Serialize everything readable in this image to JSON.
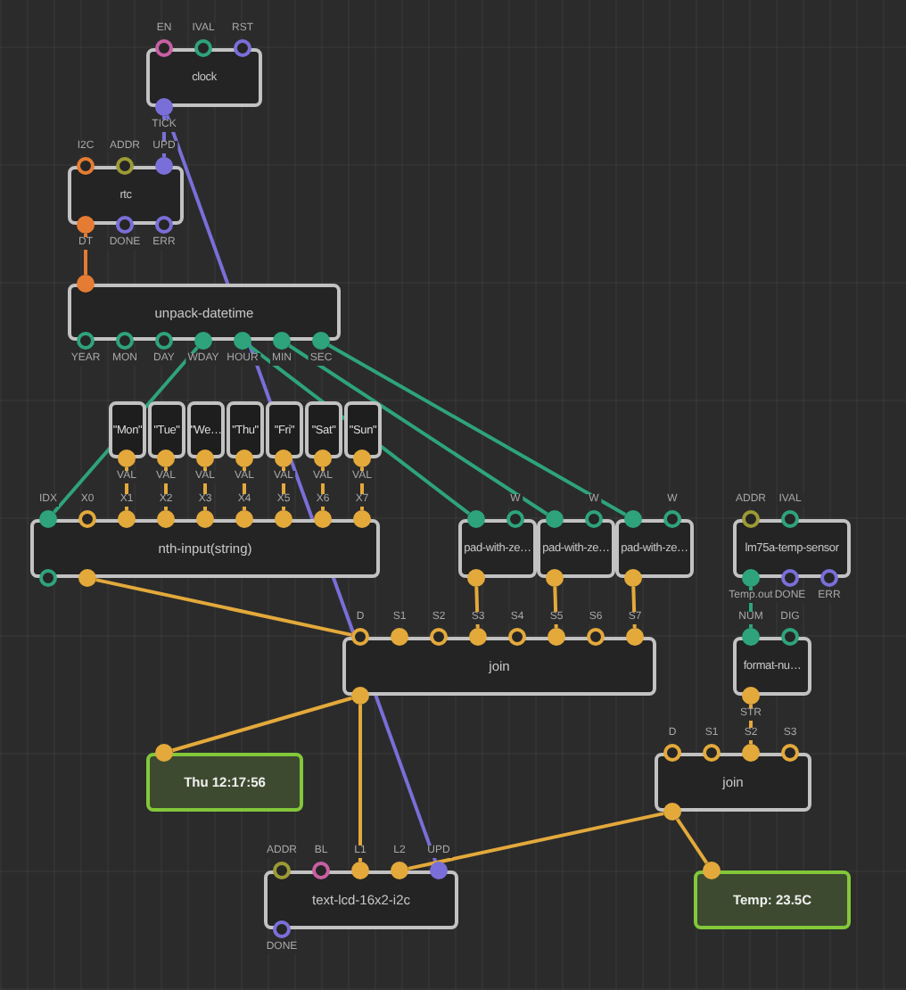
{
  "nodes": [
    {
      "kind": "patch",
      "label": "clock",
      "inputs": [
        {
          "label": "EN",
          "color": "#c760a3",
          "linked": false
        },
        {
          "label": "IVAL",
          "color": "#2ea37c",
          "linked": false
        },
        {
          "label": "RST",
          "color": "#7a6fd8",
          "linked": false
        }
      ],
      "outputs": [
        {
          "label": "TICK",
          "color": "#7a6fd8",
          "linked": true
        }
      ]
    },
    {
      "kind": "patch",
      "label": "rtc",
      "inputs": [
        {
          "label": "I2C",
          "color": "#e57c33",
          "linked": false
        },
        {
          "label": "ADDR",
          "color": "#9c9a35",
          "linked": false
        },
        {
          "label": "UPD",
          "color": "#7a6fd8",
          "linked": true
        }
      ],
      "outputs": [
        {
          "label": "DT",
          "color": "#e57c33",
          "linked": true
        },
        {
          "label": "DONE",
          "color": "#7a6fd8",
          "linked": false
        },
        {
          "label": "ERR",
          "color": "#7a6fd8",
          "linked": false
        }
      ]
    },
    {
      "kind": "patch",
      "label": "unpack-datetime",
      "inputs": [
        {
          "color": "#e57c33",
          "linked": true
        }
      ],
      "outputs": [
        {
          "label": "YEAR",
          "color": "#2ea37c",
          "linked": false
        },
        {
          "label": "MON",
          "color": "#2ea37c",
          "linked": false
        },
        {
          "label": "DAY",
          "color": "#2ea37c",
          "linked": false
        },
        {
          "label": "WDAY",
          "color": "#2ea37c",
          "linked": true
        },
        {
          "label": "HOUR",
          "color": "#2ea37c",
          "linked": true
        },
        {
          "label": "MIN",
          "color": "#2ea37c",
          "linked": true
        },
        {
          "label": "SEC",
          "color": "#2ea37c",
          "linked": true
        }
      ]
    },
    {
      "kind": "constant",
      "label": "\"Mon\"",
      "outputs": [
        {
          "label": "VAL",
          "color": "#e3a93b",
          "linked": true
        }
      ]
    },
    {
      "kind": "constant",
      "label": "\"Tue\"",
      "outputs": [
        {
          "label": "VAL",
          "color": "#e3a93b",
          "linked": true
        }
      ]
    },
    {
      "kind": "constant",
      "label": "\"We…",
      "outputs": [
        {
          "label": "VAL",
          "color": "#e3a93b",
          "linked": true
        }
      ]
    },
    {
      "kind": "constant",
      "label": "\"Thu\"",
      "outputs": [
        {
          "label": "VAL",
          "color": "#e3a93b",
          "linked": true
        }
      ]
    },
    {
      "kind": "constant",
      "label": "\"Fri\"",
      "outputs": [
        {
          "label": "VAL",
          "color": "#e3a93b",
          "linked": true
        }
      ]
    },
    {
      "kind": "constant",
      "label": "\"Sat\"",
      "outputs": [
        {
          "label": "VAL",
          "color": "#e3a93b",
          "linked": true
        }
      ]
    },
    {
      "kind": "constant",
      "label": "\"Sun\"",
      "outputs": [
        {
          "label": "VAL",
          "color": "#e3a93b",
          "linked": true
        }
      ]
    },
    {
      "kind": "patch",
      "label": "nth-input(string)",
      "inputs": [
        {
          "label": "IDX",
          "color": "#2ea37c",
          "linked": true
        },
        {
          "label": "X0",
          "color": "#e3a93b",
          "linked": false
        },
        {
          "label": "X1",
          "color": "#e3a93b",
          "linked": true
        },
        {
          "label": "X2",
          "color": "#e3a93b",
          "linked": true
        },
        {
          "label": "X3",
          "color": "#e3a93b",
          "linked": true
        },
        {
          "label": "X4",
          "color": "#e3a93b",
          "linked": true
        },
        {
          "label": "X5",
          "color": "#e3a93b",
          "linked": true
        },
        {
          "label": "X6",
          "color": "#e3a93b",
          "linked": true
        },
        {
          "label": "X7",
          "color": "#e3a93b",
          "linked": true
        }
      ],
      "outputs": [
        {
          "color": "#2ea37c",
          "linked": false
        },
        {
          "color": "#e3a93b",
          "linked": true
        }
      ]
    },
    {
      "kind": "patch",
      "label": "pad-with-ze…",
      "inputs": [
        {
          "color": "#2ea37c",
          "linked": true
        },
        {
          "label": "W",
          "color": "#2ea37c",
          "linked": false
        }
      ],
      "outputs": [
        {
          "color": "#e3a93b",
          "linked": true
        }
      ]
    },
    {
      "kind": "patch",
      "label": "pad-with-ze…",
      "inputs": [
        {
          "color": "#2ea37c",
          "linked": true
        },
        {
          "label": "W",
          "color": "#2ea37c",
          "linked": false
        }
      ],
      "outputs": [
        {
          "color": "#e3a93b",
          "linked": true
        }
      ]
    },
    {
      "kind": "patch",
      "label": "pad-with-ze…",
      "inputs": [
        {
          "color": "#2ea37c",
          "linked": true
        },
        {
          "label": "W",
          "color": "#2ea37c",
          "linked": false
        }
      ],
      "outputs": [
        {
          "color": "#e3a93b",
          "linked": true
        }
      ]
    },
    {
      "kind": "patch",
      "label": "lm75a-temp-sensor",
      "inputs": [
        {
          "label": "ADDR",
          "color": "#9c9a35",
          "linked": false
        },
        {
          "label": "IVAL",
          "color": "#2ea37c",
          "linked": false
        }
      ],
      "outputs": [
        {
          "label": "Temp.out",
          "color": "#2ea37c",
          "linked": true
        },
        {
          "label": "DONE",
          "color": "#7a6fd8",
          "linked": false
        },
        {
          "label": "ERR",
          "color": "#7a6fd8",
          "linked": false
        }
      ]
    },
    {
      "kind": "patch",
      "label": "join",
      "inputs": [
        {
          "label": "D",
          "color": "#e3a93b",
          "linked": false
        },
        {
          "label": "S1",
          "color": "#e3a93b",
          "linked": true
        },
        {
          "label": "S2",
          "color": "#e3a93b",
          "linked": false
        },
        {
          "label": "S3",
          "color": "#e3a93b",
          "linked": true
        },
        {
          "label": "S4",
          "color": "#e3a93b",
          "linked": false
        },
        {
          "label": "S5",
          "color": "#e3a93b",
          "linked": true
        },
        {
          "label": "S6",
          "color": "#e3a93b",
          "linked": false
        },
        {
          "label": "S7",
          "color": "#e3a93b",
          "linked": true
        }
      ],
      "outputs": [
        {
          "color": "#e3a93b",
          "linked": true
        }
      ]
    },
    {
      "kind": "patch",
      "label": "format-nu…",
      "inputs": [
        {
          "label": "NUM",
          "color": "#2ea37c",
          "linked": true
        },
        {
          "label": "DIG",
          "color": "#2ea37c",
          "linked": false
        }
      ],
      "outputs": [
        {
          "label": "STR",
          "color": "#e3a93b",
          "linked": true
        }
      ]
    },
    {
      "kind": "watch",
      "label": "Thu 12:17:56",
      "inputs": [
        {
          "color": "#e3a93b",
          "linked": true
        }
      ]
    },
    {
      "kind": "patch",
      "label": "join",
      "inputs": [
        {
          "label": "D",
          "color": "#e3a93b",
          "linked": false
        },
        {
          "label": "S1",
          "color": "#e3a93b",
          "linked": false
        },
        {
          "label": "S2",
          "color": "#e3a93b",
          "linked": true
        },
        {
          "label": "S3",
          "color": "#e3a93b",
          "linked": false
        }
      ],
      "outputs": [
        {
          "color": "#e3a93b",
          "linked": true
        }
      ]
    },
    {
      "kind": "patch",
      "label": "text-lcd-16x2-i2c",
      "inputs": [
        {
          "label": "ADDR",
          "color": "#9c9a35",
          "linked": false
        },
        {
          "label": "BL",
          "color": "#c760a3",
          "linked": false
        },
        {
          "label": "L1",
          "color": "#e3a93b",
          "linked": true
        },
        {
          "label": "L2",
          "color": "#e3a93b",
          "linked": true
        },
        {
          "label": "UPD",
          "color": "#7a6fd8",
          "linked": true
        }
      ],
      "outputs": [
        {
          "label": "DONE",
          "color": "#7a6fd8",
          "linked": false
        }
      ]
    },
    {
      "kind": "watch",
      "label": "Temp: 23.5C",
      "inputs": [
        {
          "color": "#e3a93b",
          "linked": true
        }
      ]
    }
  ]
}
